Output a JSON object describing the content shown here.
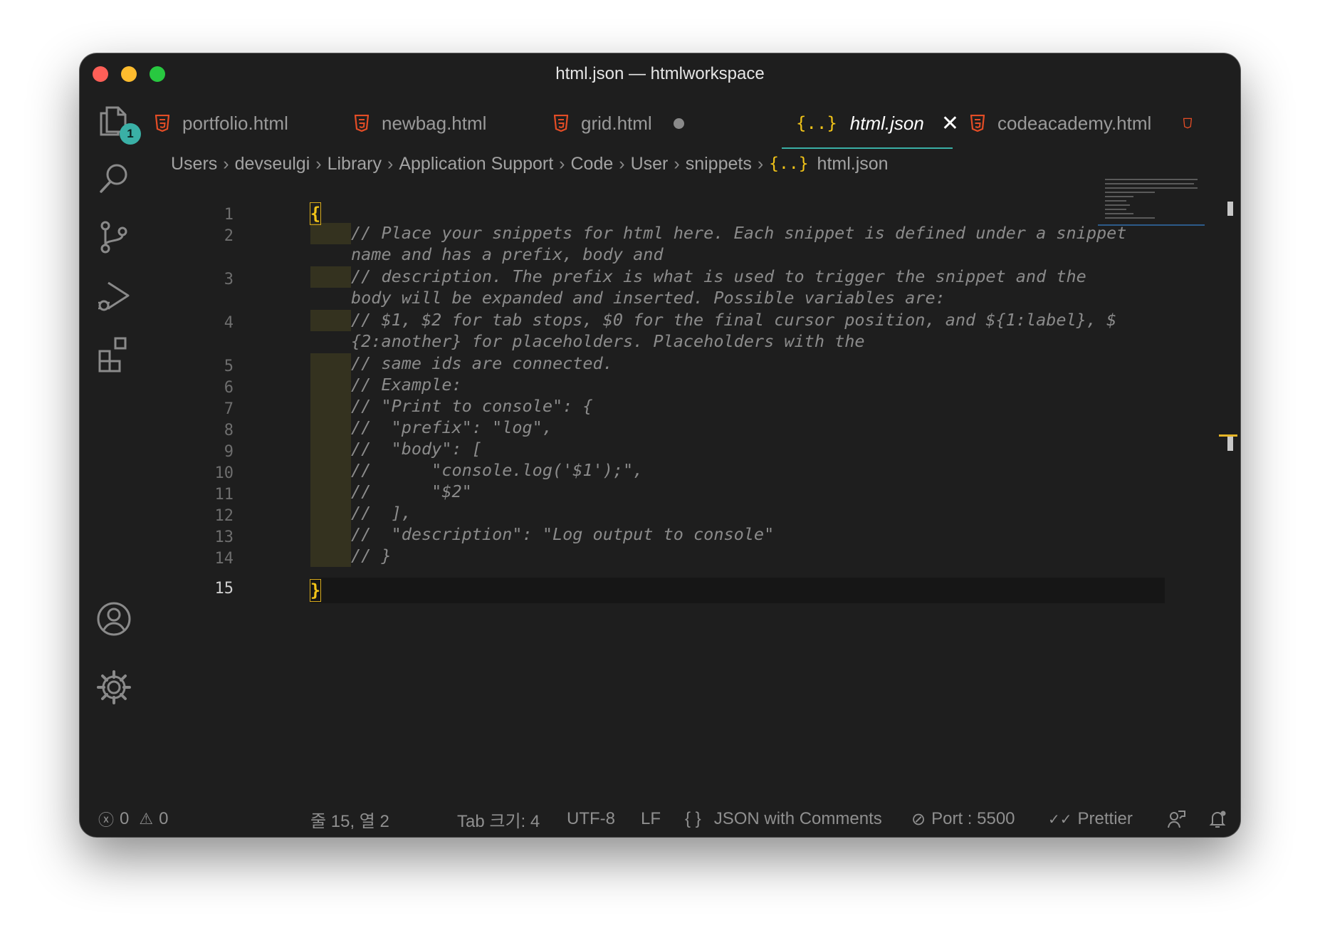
{
  "window": {
    "title": "html.json — htmlworkspace"
  },
  "activity_bar": {
    "explorer_badge": "1"
  },
  "tabs": [
    {
      "label": "portfolio.html",
      "icon": "html5-icon",
      "modified": false,
      "active": false
    },
    {
      "label": "newbag.html",
      "icon": "html5-icon",
      "modified": false,
      "active": false
    },
    {
      "label": "grid.html",
      "icon": "html5-icon",
      "modified": true,
      "active": false
    },
    {
      "label": "html.json",
      "icon": "json-braces-icon",
      "modified": false,
      "active": true
    },
    {
      "label": "codeacademy.html",
      "icon": "html5-icon",
      "modified": false,
      "active": false
    }
  ],
  "breadcrumb": [
    "Users",
    "devseulgi",
    "Library",
    "Application Support",
    "Code",
    "User",
    "snippets",
    "html.json"
  ],
  "editor": {
    "line_numbers": [
      "1",
      "2",
      "3",
      "4",
      "5",
      "6",
      "7",
      "8",
      "9",
      "10",
      "11",
      "12",
      "13",
      "14",
      "15"
    ],
    "lines": [
      "{",
      "// Place your snippets for html here. Each snippet is defined under a snippet",
      "name and has a prefix, body and",
      "// description. The prefix is what is used to trigger the snippet and the",
      "body will be expanded and inserted. Possible variables are:",
      "// $1, $2 for tab stops, $0 for the final cursor position, and ${1:label}, $",
      "{2:another} for placeholders. Placeholders with the",
      "// same ids are connected.",
      "// Example:",
      "// \"Print to console\": {",
      "//  \"prefix\": \"log\",",
      "//  \"body\": [",
      "//      \"console.log('$1');\",",
      "//      \"$2\"",
      "//  ],",
      "//  \"description\": \"Log output to console\"",
      "// }",
      "}"
    ],
    "current_line": "15"
  },
  "status_bar": {
    "errors": "0",
    "warnings": "0",
    "cursor": "줄 15, 열 2",
    "tab_size": "Tab 크기: 4",
    "encoding": "UTF-8",
    "eol": "LF",
    "language_icon": "{ }",
    "language": "JSON with Comments",
    "port": "Port : 5500",
    "formatter": "Prettier"
  },
  "colors": {
    "background": "#1e1e1e",
    "accent": "#3ab0a6",
    "bracket": "#f2c418",
    "html_icon": "#e44d26",
    "json_icon": "#f2c418"
  }
}
